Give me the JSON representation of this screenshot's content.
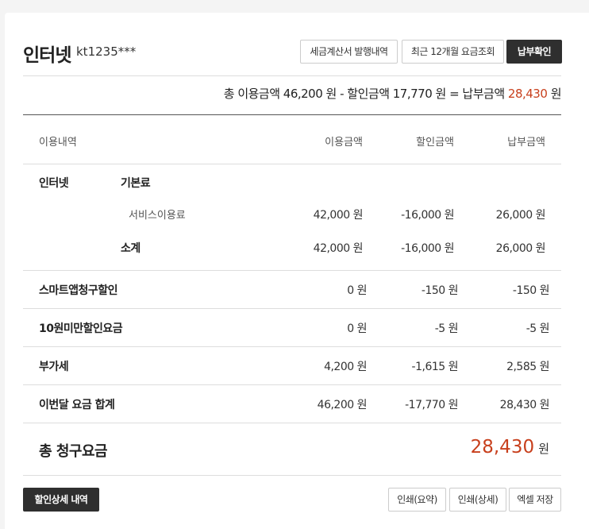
{
  "header": {
    "title": "인터넷",
    "account": "kt1235***",
    "buttons": [
      "세금계산서 발행내역",
      "최근 12개월 요금조회",
      "납부확인"
    ]
  },
  "summary": {
    "text1": "총 이용금액 46,200 원 - 할인금액 17,770 원 = 납부금액",
    "pay_value": "28,430",
    "unit": "원"
  },
  "table": {
    "headers": [
      "이용내역",
      "이용금액",
      "할인금액",
      "납부금액"
    ],
    "internet": {
      "category": "인터넷",
      "sub1": "기본료",
      "item": "서비스이용료",
      "item_use": "42,000 원",
      "item_discount": "-16,000 원",
      "item_pay": "26,000 원",
      "subtotal_label": "소계",
      "subtotal_use": "42,000 원",
      "subtotal_discount": "-16,000 원",
      "subtotal_pay": "26,000 원"
    },
    "rows": [
      {
        "label": "스마트앱청구할인",
        "use": "0 원",
        "discount": "-150 원",
        "pay": "-150 원"
      },
      {
        "label": "10원미만할인요금",
        "use": "0 원",
        "discount": "-5 원",
        "pay": "-5 원"
      },
      {
        "label": "부가세",
        "use": "4,200 원",
        "discount": "-1,615 원",
        "pay": "2,585 원"
      },
      {
        "label": "이번달 요금 합계",
        "use": "46,200 원",
        "discount": "-17,770 원",
        "pay": "28,430 원"
      }
    ],
    "total": {
      "label": "총 청구요금",
      "value": "28,430",
      "unit": "원"
    }
  },
  "footer": {
    "discount_detail": "할인상세 내역",
    "print_summary": "인쇄(요약)",
    "print_detail": "인쇄(상세)",
    "excel_save": "엑셀 저장"
  },
  "colors": {
    "accent": "#c8401d",
    "dark_button": "#2f2f2f"
  }
}
